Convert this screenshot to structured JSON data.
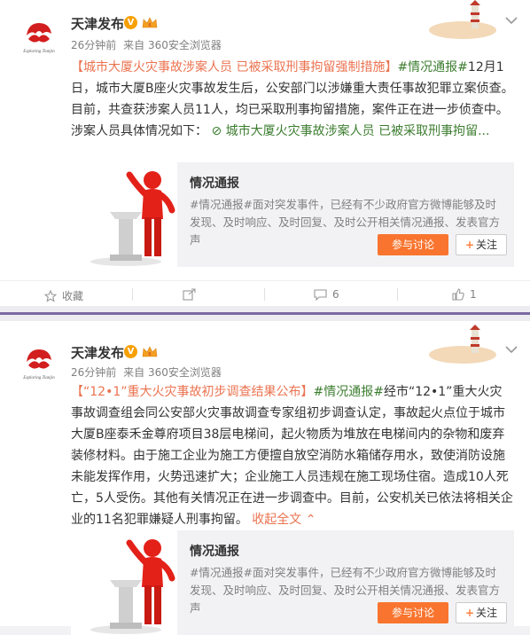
{
  "posts": [
    {
      "author": "天津发布",
      "verified": "V",
      "time": "26分钟前",
      "source_prefix": "来自",
      "source": "360安全浏览器",
      "text": {
        "link": "【城市大厦火灾事故涉案人员 已被采取刑事拘留强制措施】",
        "topic": "#情况通报#",
        "body": "12月1日，城市大厦B座火灾事故发生后，公安部门以涉嫌重大责任事故犯罪立案侦查。目前，共查获涉案人员11人，均已采取刑事拘留措施，案件正在进一步侦查中。涉案人员具体情况如下：",
        "link2": "城市大厦火灾事故涉案人员 已被采取刑事拘留...",
        "fold": ""
      },
      "card": {
        "title": "情况通报",
        "desc": "#情况通报#面对突发事件，已经有不少政府官方微博能够及时发现、及时响应、及时回复、及时公开相关情况通报、发表官方声",
        "discuss_label": "参与讨论",
        "follow_label": "关注"
      },
      "actions": {
        "favorite": "收藏",
        "repost": "",
        "comment": "6",
        "like": "1"
      }
    },
    {
      "author": "天津发布",
      "verified": "V",
      "time": "26分钟前",
      "source_prefix": "来自",
      "source": "360安全浏览器",
      "text": {
        "link": "【“12•1”重大火灾事故初步调查结果公布】",
        "topic": "#情况通报#",
        "body": "经市“12•1”重大火灾事故调查组会同公安部火灾事故调查专家组初步调查认定，事故起火点位于城市大厦B座泰禾金尊府项目38层电梯间，起火物质为堆放在电梯间内的杂物和废弃装修材料。由于施工企业为施工方便擅自放空消防水箱储存用水，致使消防设施未能发挥作用，火势迅速扩大；企业施工人员违规在施工现场住宿。造成10人死亡，5人受伤。其他有关情况正在进一步调查中。目前，公安机关已依法将相关企业的11名犯罪嫌疑人刑事拘留。",
        "fold": "收起全文"
      },
      "card": {
        "title": "情况通报",
        "desc": "#情况通报#面对突发事件，已经有不少政府官方微博能够及时发现、及时响应、及时回复、及时公开相关情况通报、发表官方声",
        "discuss_label": "参与讨论",
        "follow_label": "关注"
      }
    }
  ],
  "colors": {
    "accent_orange": "#eb7350",
    "topic_green": "#3c7d2f",
    "button_orange": "#f9752f",
    "divider_purple": "#7b6aa3"
  },
  "icons": [
    "logo-avatar",
    "verified-badge-icon",
    "crown-icon",
    "chevron-down-icon",
    "lighthouse-deco",
    "podium-figure-image",
    "favorite-icon",
    "repost-icon",
    "comment-icon",
    "like-icon"
  ]
}
